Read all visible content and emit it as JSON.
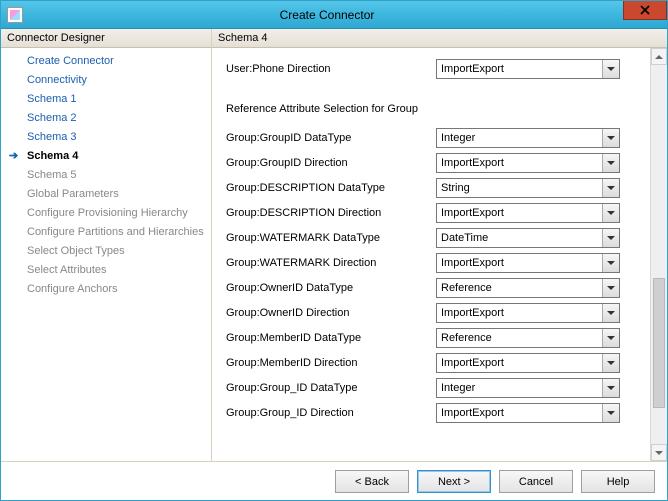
{
  "window": {
    "title": "Create Connector"
  },
  "leftPanel": {
    "header": "Connector Designer",
    "items": [
      {
        "label": "Create Connector",
        "state": "done"
      },
      {
        "label": "Connectivity",
        "state": "done"
      },
      {
        "label": "Schema 1",
        "state": "done"
      },
      {
        "label": "Schema 2",
        "state": "done"
      },
      {
        "label": "Schema 3",
        "state": "done"
      },
      {
        "label": "Schema 4",
        "state": "current"
      },
      {
        "label": "Schema 5",
        "state": "upcoming"
      },
      {
        "label": "Global Parameters",
        "state": "upcoming"
      },
      {
        "label": "Configure Provisioning Hierarchy",
        "state": "upcoming"
      },
      {
        "label": "Configure Partitions and Hierarchies",
        "state": "upcoming"
      },
      {
        "label": "Select Object Types",
        "state": "upcoming"
      },
      {
        "label": "Select Attributes",
        "state": "upcoming"
      },
      {
        "label": "Configure Anchors",
        "state": "upcoming"
      }
    ]
  },
  "rightPanel": {
    "header": "Schema 4",
    "topRow": {
      "label": "User:Phone Direction",
      "value": "ImportExport"
    },
    "sectionTitle": "Reference Attribute Selection for Group",
    "rows": [
      {
        "label": "Group:GroupID DataType",
        "value": "Integer"
      },
      {
        "label": "Group:GroupID Direction",
        "value": "ImportExport"
      },
      {
        "label": "Group:DESCRIPTION DataType",
        "value": "String"
      },
      {
        "label": "Group:DESCRIPTION Direction",
        "value": "ImportExport"
      },
      {
        "label": "Group:WATERMARK DataType",
        "value": "DateTime"
      },
      {
        "label": "Group:WATERMARK Direction",
        "value": "ImportExport"
      },
      {
        "label": "Group:OwnerID DataType",
        "value": "Reference"
      },
      {
        "label": "Group:OwnerID Direction",
        "value": "ImportExport"
      },
      {
        "label": "Group:MemberID DataType",
        "value": "Reference"
      },
      {
        "label": "Group:MemberID Direction",
        "value": "ImportExport"
      },
      {
        "label": "Group:Group_ID DataType",
        "value": "Integer"
      },
      {
        "label": "Group:Group_ID Direction",
        "value": "ImportExport"
      }
    ]
  },
  "footer": {
    "back": "<  Back",
    "next": "Next  >",
    "cancel": "Cancel",
    "help": "Help"
  }
}
